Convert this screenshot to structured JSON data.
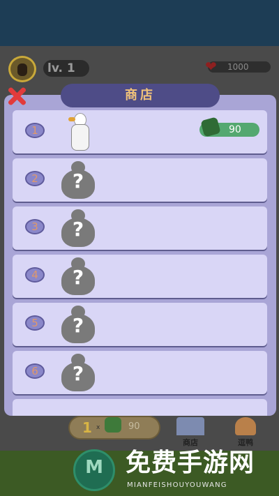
{
  "hud": {
    "level_label": "lv.",
    "level_value": "1",
    "hp_value": "1000",
    "colors": {
      "hp": "#8e2020",
      "topbar": "#1d3d55"
    }
  },
  "shop": {
    "title": "商店",
    "close_icon": "close-icon",
    "items": [
      {
        "number": "1",
        "unlocked": true,
        "price": "90",
        "icon": "duck-icon"
      },
      {
        "number": "2",
        "unlocked": false,
        "locked_text": "?",
        "icon": "locked-duck-icon"
      },
      {
        "number": "3",
        "unlocked": false,
        "locked_text": "?",
        "icon": "locked-duck-icon"
      },
      {
        "number": "4",
        "unlocked": false,
        "locked_text": "?",
        "icon": "locked-duck-icon"
      },
      {
        "number": "5",
        "unlocked": false,
        "locked_text": "?",
        "icon": "locked-duck-icon"
      },
      {
        "number": "6",
        "unlocked": false,
        "locked_text": "?",
        "icon": "locked-duck-icon"
      }
    ],
    "colors": {
      "panel": "#a9a5d6",
      "row": "#d9d6f6",
      "title_bg": "#4e4c87",
      "price_pill": "#54a870"
    }
  },
  "bottom": {
    "count": "1",
    "multiplier": "x",
    "price": "90",
    "nav_shop_label": "商店",
    "nav_duck_label": "逗鸭"
  },
  "watermark": {
    "title": "免费手游网",
    "subtitle": "MIANFEISHOUYOUWANG"
  }
}
